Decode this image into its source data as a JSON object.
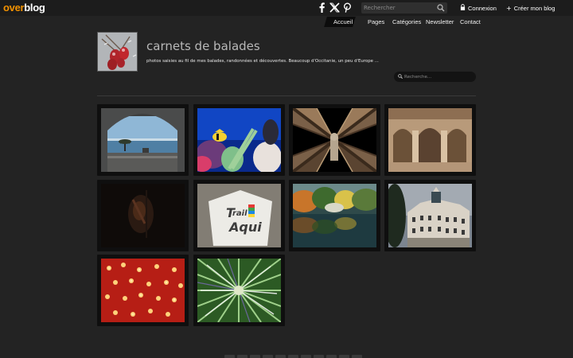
{
  "topbar": {
    "logo_part1": "over",
    "logo_part2": "blog",
    "search_placeholder": "Rechercher",
    "login_label": "Connexion",
    "create_blog_label": "Créer mon blog",
    "social_icons": [
      "facebook-icon",
      "x-icon",
      "pinterest-icon"
    ]
  },
  "nav": {
    "items": [
      {
        "label": "Accueil",
        "active": true
      },
      {
        "label": "Pages",
        "active": false
      },
      {
        "label": "Catégories",
        "active": false
      },
      {
        "label": "Newsletter",
        "active": false
      },
      {
        "label": "Contact",
        "active": false
      }
    ]
  },
  "header": {
    "title": "carnets de balades",
    "description": "photos saisies au fil de mes balades, randonnées et découvertes. Beaucoup d'Occitanie, un peu d'Europe ...",
    "search_placeholder": "Recherche..."
  },
  "colors": {
    "background": "#232323",
    "topbar": "#1c1c1c",
    "brand_orange": "#f39200"
  }
}
